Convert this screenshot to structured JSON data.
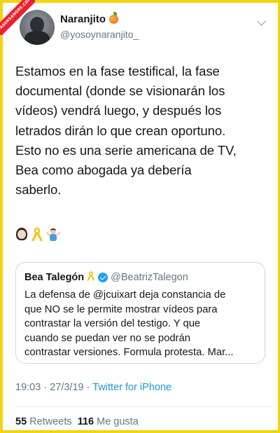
{
  "watermark": {
    "text": "ASENSANGRE.COM"
  },
  "author": {
    "name": "Naranjito",
    "name_emoji": "peach-icon",
    "handle": "@yosoynaranjito_"
  },
  "tweet": {
    "text": "Estamos en la fase testifical, la fase\ndocumental (donde se visionarán los\nvídeos) vendrá luego, y después los\nletrados dirán lo que crean oportuno.\nEsto no es una serie americana de TV,\nBea como abogada ya debería\nsaberlo.",
    "emojis": [
      "woman-icon",
      "yellow-ribbon-icon",
      "man-shrugging-icon"
    ]
  },
  "quoted": {
    "name": "Bea Talegón",
    "handle": "@BeatrizTalegon",
    "text": "La defensa de @jcuixart deja constancia de\nque NO se le permite mostrar vídeos para\ncontrastar la versión del testigo. Y que\ncuando se puedan ver no se podrán\ncontrastar versiones. Formula protesta. Mar..."
  },
  "meta": {
    "time": "19:03",
    "separator": "·",
    "date": "27/3/19",
    "source": "Twitter for iPhone"
  },
  "stats": {
    "retweets_count": "55",
    "retweets_label": "Retweets",
    "likes_count": "116",
    "likes_label": "Me gusta"
  },
  "colors": {
    "frame": "#f2d40f",
    "link": "#1b95e0",
    "muted": "#657786"
  }
}
